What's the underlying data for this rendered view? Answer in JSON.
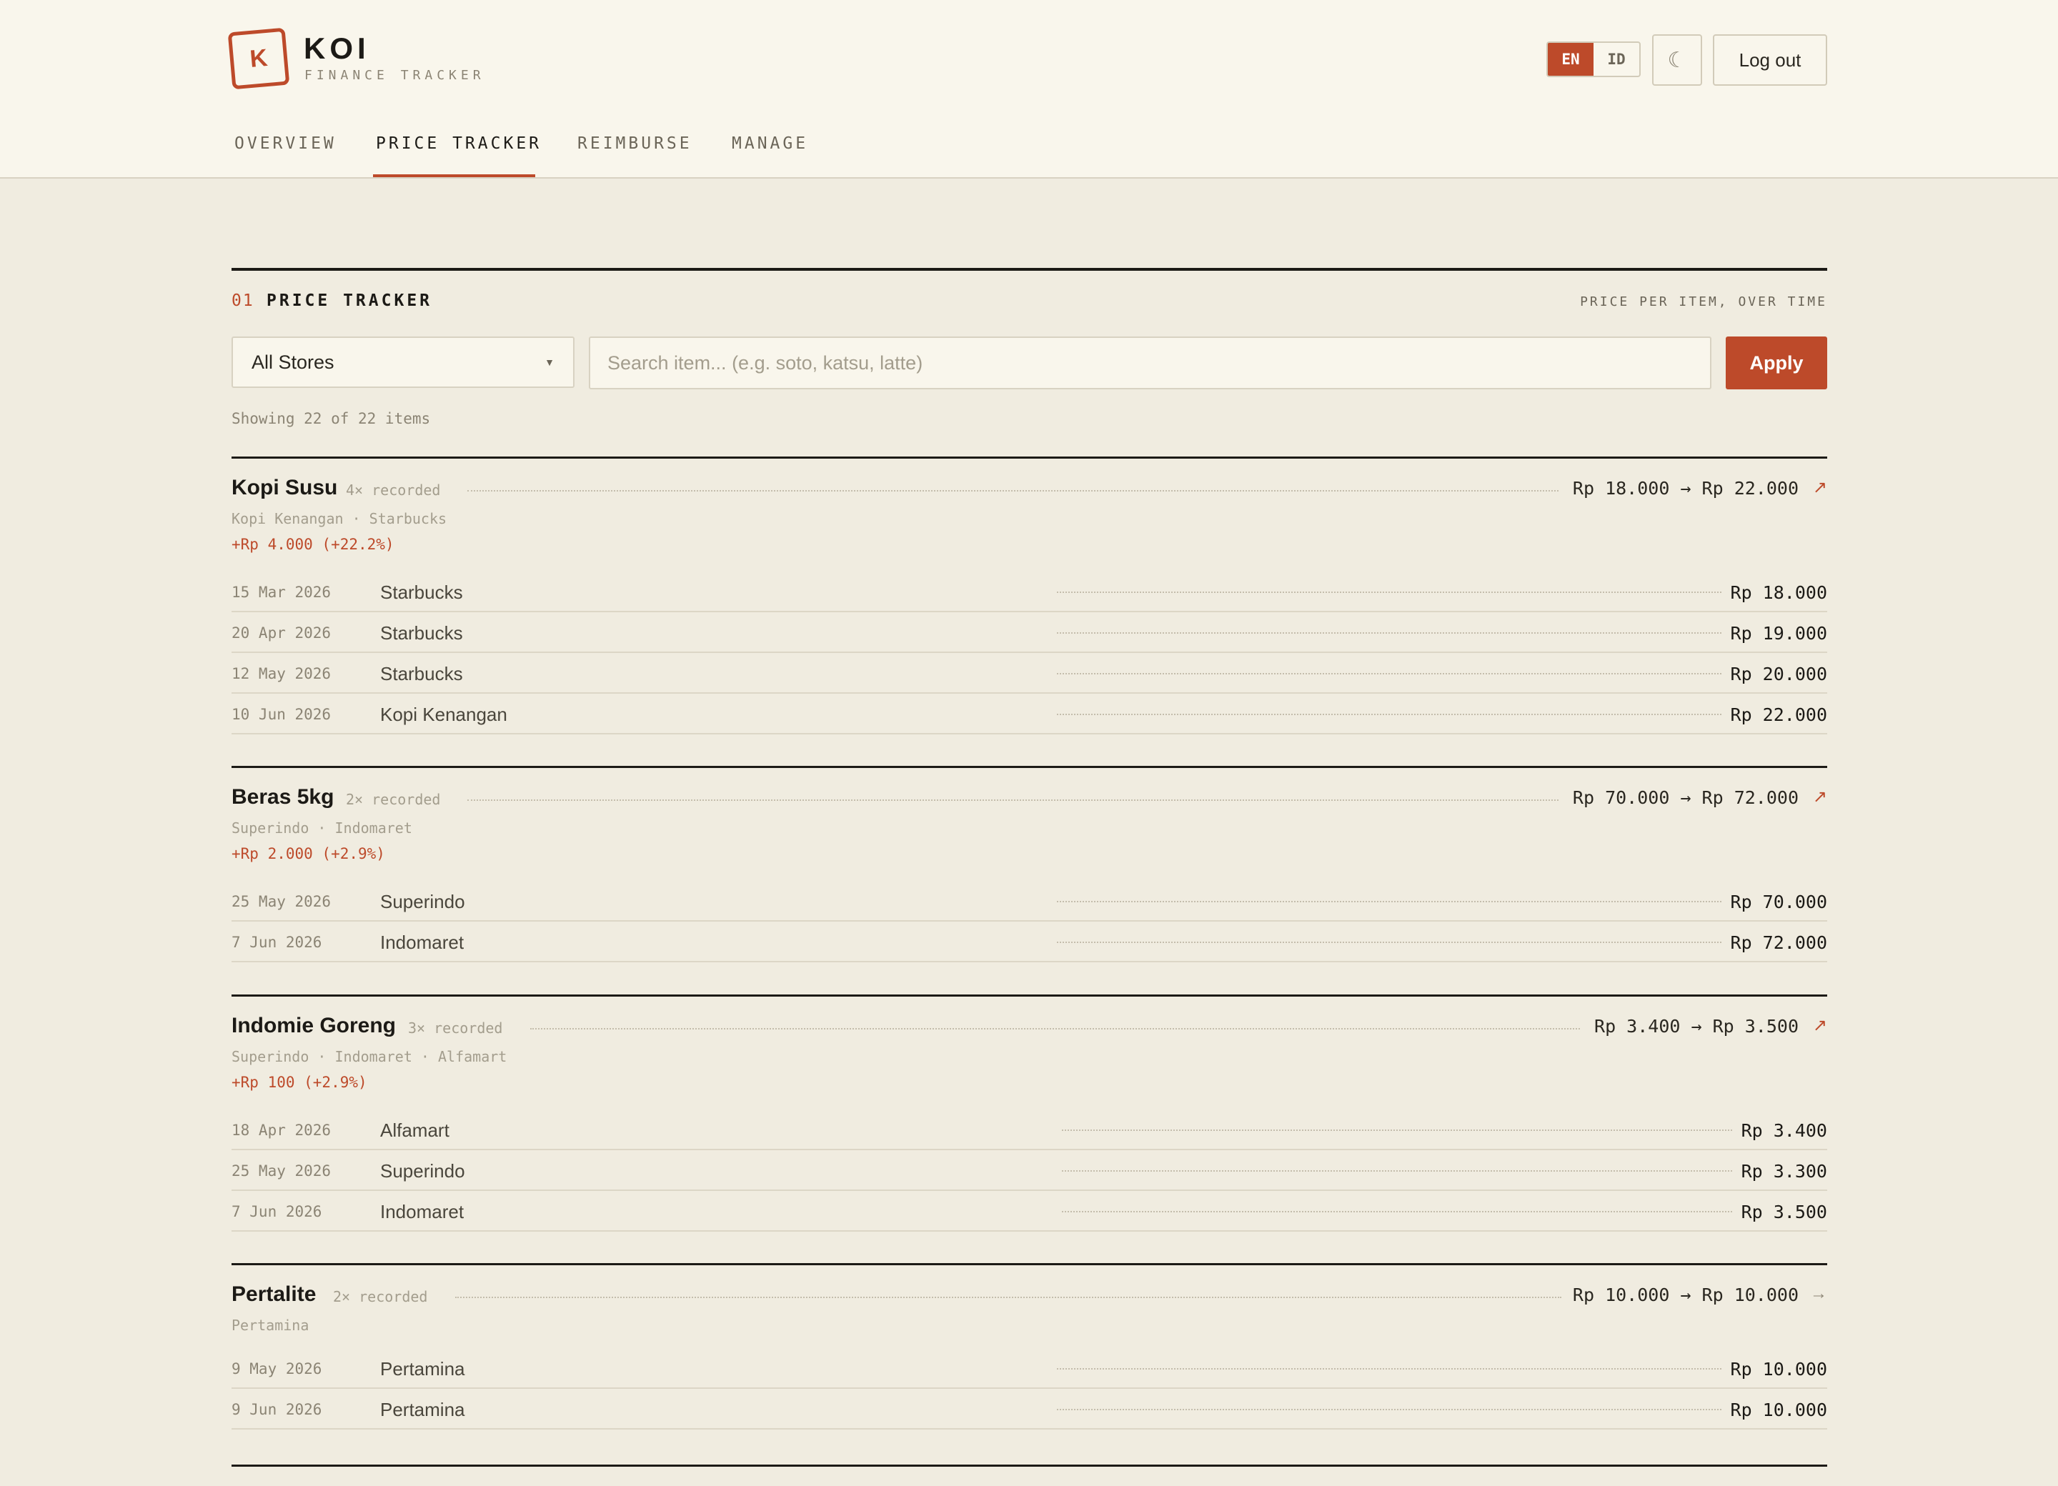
{
  "brand": {
    "logo_letter": "K",
    "title": "KOI",
    "subtitle": "FINANCE TRACKER"
  },
  "header_controls": {
    "lang_en": "EN",
    "lang_id": "ID",
    "active_lang": "EN",
    "theme_icon": "moon-icon",
    "theme_glyph": "☾",
    "logout_label": "Log out"
  },
  "nav": {
    "tabs": [
      "OVERVIEW",
      "PRICE TRACKER",
      "REIMBURSE",
      "MANAGE"
    ],
    "active_tab": "PRICE TRACKER"
  },
  "section": {
    "number": "01",
    "title": "PRICE TRACKER",
    "caption": "PRICE PER ITEM, OVER TIME"
  },
  "filters": {
    "store_value": "All Stores",
    "search_placeholder": "Search item... (e.g. soto, katsu, latte)",
    "apply_label": "Apply"
  },
  "showing_text": "Showing 22 of 22 items",
  "colors": {
    "accent": "#bd4a2a",
    "background": "#f0ece0",
    "header_bg": "#f9f6ec",
    "text": "#1c1a16"
  },
  "groups": [
    {
      "name": "Kopi Susu",
      "count": "4× recorded",
      "range": "Rp 18.000 → Rp 22.000",
      "trend": "↗",
      "stores": "Kopi Kenangan · Starbucks",
      "change": "+Rp 4.000 (+22.2%)",
      "rows": [
        {
          "date": "15 Mar 2026",
          "store": "Starbucks",
          "price": "Rp 18.000"
        },
        {
          "date": "20 Apr 2026",
          "store": "Starbucks",
          "price": "Rp 19.000"
        },
        {
          "date": "12 May 2026",
          "store": "Starbucks",
          "price": "Rp 20.000"
        },
        {
          "date": "10 Jun 2026",
          "store": "Kopi Kenangan",
          "price": "Rp 22.000"
        }
      ]
    },
    {
      "name": "Beras 5kg",
      "count": "2× recorded",
      "range": "Rp 70.000 → Rp 72.000",
      "trend": "↗",
      "stores": "Superindo · Indomaret",
      "change": "+Rp 2.000 (+2.9%)",
      "rows": [
        {
          "date": "25 May 2026",
          "store": "Superindo",
          "price": "Rp 70.000"
        },
        {
          "date": "7 Jun 2026",
          "store": "Indomaret",
          "price": "Rp 72.000"
        }
      ]
    },
    {
      "name": "Indomie Goreng",
      "count": "3× recorded",
      "range": "Rp 3.400 → Rp 3.500",
      "trend": "↗",
      "stores": "Superindo · Indomaret · Alfamart",
      "change": "+Rp 100 (+2.9%)",
      "rows": [
        {
          "date": "18 Apr 2026",
          "store": "Alfamart",
          "price": "Rp 3.400"
        },
        {
          "date": "25 May 2026",
          "store": "Superindo",
          "price": "Rp 3.300"
        },
        {
          "date": "7 Jun 2026",
          "store": "Indomaret",
          "price": "Rp 3.500"
        }
      ]
    },
    {
      "name": "Pertalite",
      "count": "2× recorded",
      "range": "Rp 10.000 → Rp 10.000",
      "trend": "→",
      "stores": "Pertamina",
      "change": "",
      "rows": [
        {
          "date": "9 May 2026",
          "store": "Pertamina",
          "price": "Rp 10.000"
        },
        {
          "date": "9 Jun 2026",
          "store": "Pertamina",
          "price": "Rp 10.000"
        }
      ]
    }
  ]
}
